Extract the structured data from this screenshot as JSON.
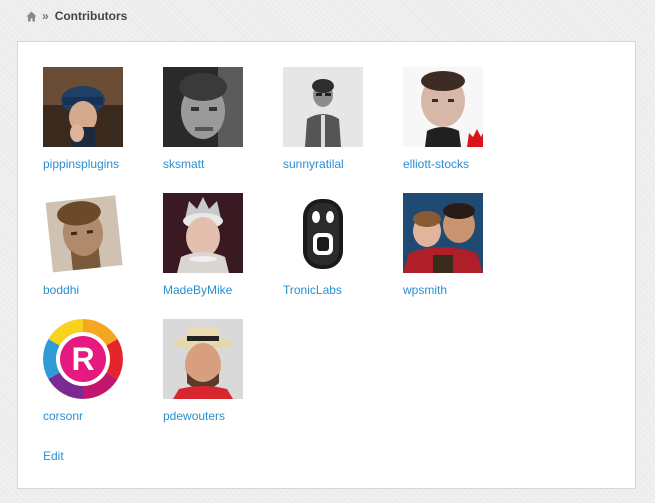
{
  "breadcrumb": {
    "home_icon": "home-icon",
    "separator": "»",
    "title": "Contributors"
  },
  "colors": {
    "link": "#2a8fd1",
    "panel_border": "#d6d6d6",
    "page_bg": "#ececec"
  },
  "contributors": [
    {
      "name": "pippinsplugins"
    },
    {
      "name": "sksmatt"
    },
    {
      "name": "sunnyratilal"
    },
    {
      "name": "elliott-stocks"
    },
    {
      "name": "boddhi"
    },
    {
      "name": "MadeByMike"
    },
    {
      "name": "TronicLabs"
    },
    {
      "name": "wpsmith"
    },
    {
      "name": "corsonr"
    },
    {
      "name": "pdewouters"
    }
  ],
  "edit_label": "Edit"
}
